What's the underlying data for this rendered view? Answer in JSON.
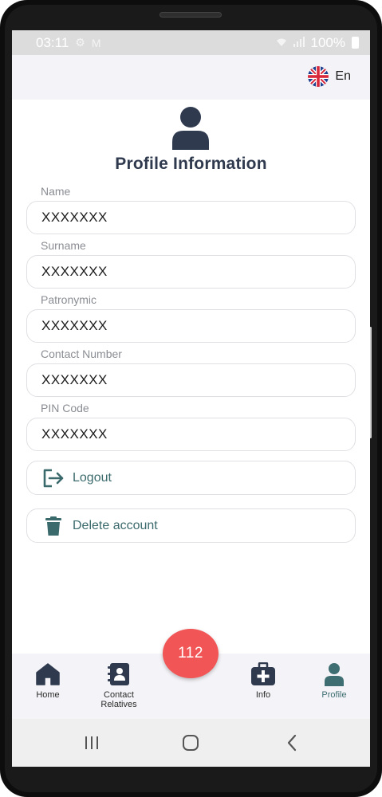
{
  "status_bar": {
    "time": "03:11",
    "notification_icons": [
      "settings-icon",
      "gmail-icon"
    ],
    "signal_icons": [
      "wifi-icon",
      "signal-icon"
    ],
    "battery_percent": "100%"
  },
  "header": {
    "language_label": "En",
    "flag_icon": "uk-flag-icon"
  },
  "profile": {
    "title": "Profile Information",
    "fields": [
      {
        "label": "Name",
        "value": "XXXXXXX"
      },
      {
        "label": "Surname",
        "value": "XXXXXXX"
      },
      {
        "label": "Patronymic",
        "value": "XXXXXXX"
      },
      {
        "label": "Contact Number",
        "value": "XXXXXXX"
      },
      {
        "label": "PIN Code",
        "value": "XXXXXXX"
      }
    ]
  },
  "actions": {
    "logout_label": "Logout",
    "delete_label": "Delete account"
  },
  "emergency": {
    "label": "112",
    "color": "#f25555"
  },
  "bottom_nav": {
    "items": [
      {
        "label": "Home",
        "icon": "home-icon"
      },
      {
        "label": "Contact Relatives",
        "icon": "contact-book-icon"
      },
      {
        "label": "Info",
        "icon": "medical-kit-icon"
      },
      {
        "label": "Profile",
        "icon": "person-icon",
        "active": true
      }
    ]
  },
  "colors": {
    "accent": "#3e6e71",
    "title": "#2f3a4f",
    "emergency": "#f25555"
  }
}
